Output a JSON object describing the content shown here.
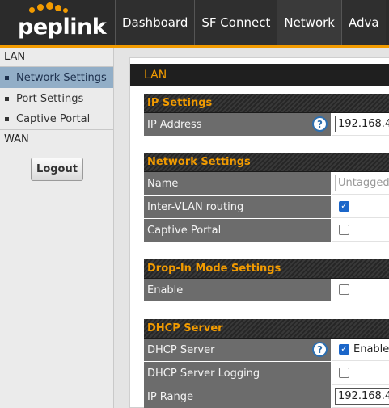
{
  "brand": {
    "logo_text": "peplink",
    "accent": "#f29b00"
  },
  "nav": {
    "tabs": [
      {
        "label": "Dashboard",
        "active": false
      },
      {
        "label": "SF Connect",
        "active": false
      },
      {
        "label": "Network",
        "active": true
      },
      {
        "label": "Adva",
        "active": false
      }
    ]
  },
  "sidebar": {
    "sections": [
      {
        "title": "LAN",
        "items": [
          "Network Settings",
          "Port Settings",
          "Captive Portal"
        ],
        "active_item": "Network Settings"
      },
      {
        "title": "WAN",
        "items": []
      }
    ],
    "logout_label": "Logout"
  },
  "page": {
    "title": "LAN",
    "panels": {
      "ip_settings": {
        "header": "IP Settings",
        "rows": [
          {
            "label": "IP Address",
            "value": "192.168.4",
            "help": "?"
          }
        ]
      },
      "network_settings": {
        "header": "Network Settings",
        "rows": [
          {
            "label": "Name",
            "placeholder": "Untagged"
          },
          {
            "label": "Inter-VLAN routing",
            "checked": true
          },
          {
            "label": "Captive Portal",
            "checked": false
          }
        ]
      },
      "drop_in": {
        "header": "Drop-In Mode Settings",
        "rows": [
          {
            "label": "Enable",
            "checked": false
          }
        ]
      },
      "dhcp": {
        "header": "DHCP Server",
        "rows": [
          {
            "label": "DHCP Server",
            "checked": true,
            "check_label": "Enable",
            "help": "?"
          },
          {
            "label": "DHCP Server Logging",
            "checked": false
          },
          {
            "label": "IP Range",
            "value": "192.168.4"
          }
        ]
      }
    }
  }
}
